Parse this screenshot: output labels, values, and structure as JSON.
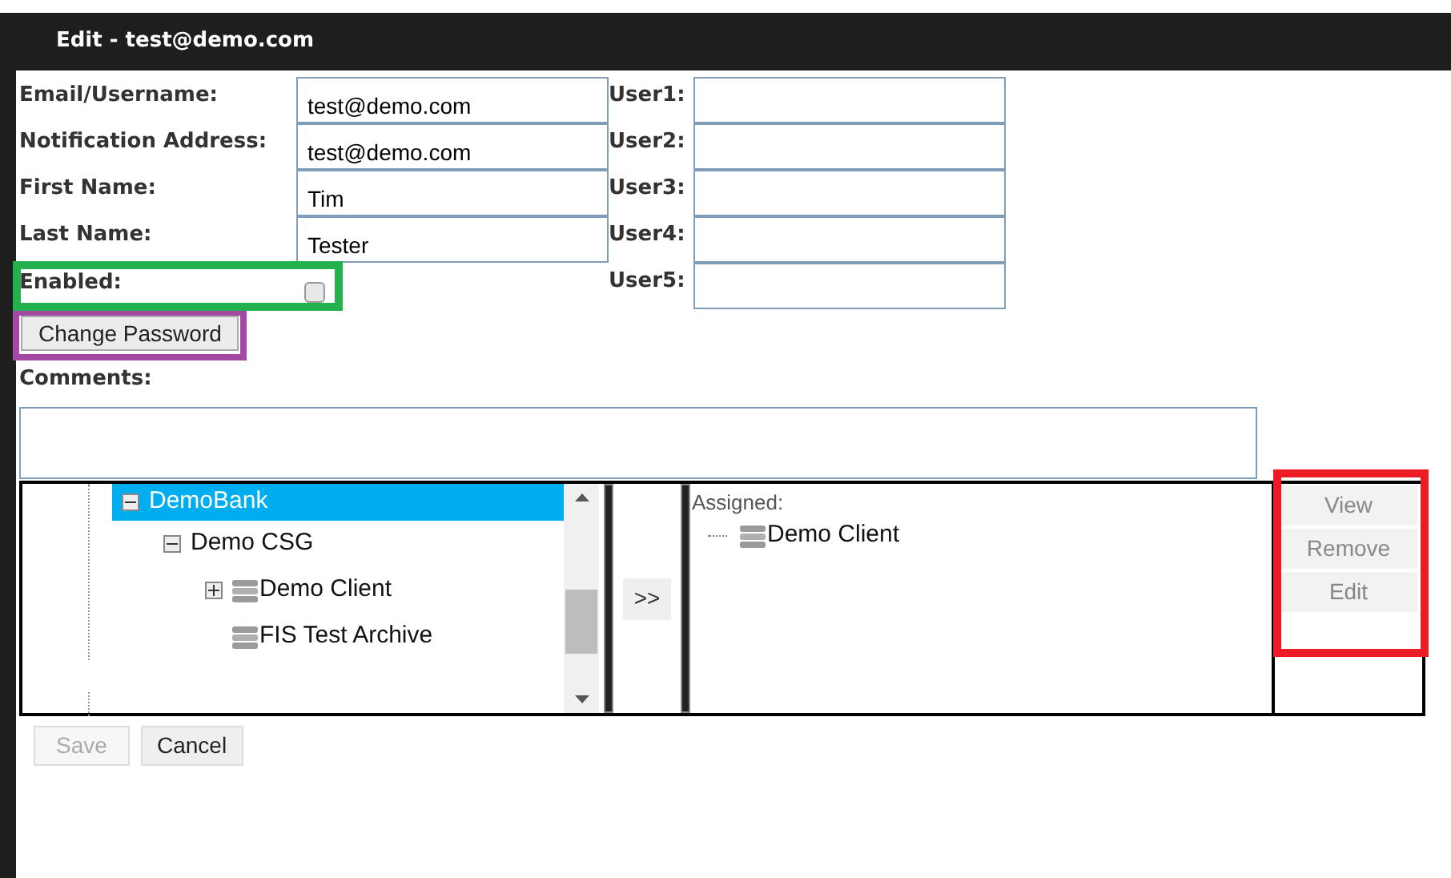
{
  "window": {
    "title": "Edit - test@demo.com"
  },
  "left_fields": [
    {
      "label": "Email/Username:",
      "value": "test@demo.com"
    },
    {
      "label": "Notification Address:",
      "value": "test@demo.com"
    },
    {
      "label": "First Name:",
      "value": "Tim"
    },
    {
      "label": "Last Name:",
      "value": "Tester"
    }
  ],
  "enabled": {
    "label": "Enabled:",
    "checked": false,
    "color": "#22b14c"
  },
  "user_fields": [
    {
      "label": "User1:"
    },
    {
      "label": "User2:"
    },
    {
      "label": "User3:"
    },
    {
      "label": "User4:"
    },
    {
      "label": "User5:"
    }
  ],
  "change_password": {
    "label": "Change Password",
    "color": "#a349a4"
  },
  "comments": {
    "label": "Comments:"
  },
  "tree": [
    {
      "label": "DemoBank",
      "selected": true,
      "expanded": true,
      "children": [
        {
          "label": "Demo CSG",
          "selected": false,
          "expanded": true,
          "children": [
            {
              "label": "Demo Client",
              "selected": false,
              "expanded": false,
              "kind": "database"
            },
            {
              "label": "FIS Test Archive",
              "selected": false,
              "kind": "database"
            }
          ]
        }
      ]
    }
  ],
  "move_button": {
    "label": ">>"
  },
  "assigned": {
    "label": "Assigned:",
    "items": [
      {
        "label": "Demo Client",
        "kind": "database"
      }
    ]
  },
  "side_buttons": {
    "color": "#ed1c24",
    "items": [
      {
        "label": "View",
        "disabled": true
      },
      {
        "label": "Remove",
        "disabled": true
      },
      {
        "label": "Edit",
        "disabled": true
      }
    ]
  },
  "footer_buttons": [
    {
      "label": "Save",
      "disabled": true
    },
    {
      "label": "Cancel",
      "disabled": false
    }
  ]
}
